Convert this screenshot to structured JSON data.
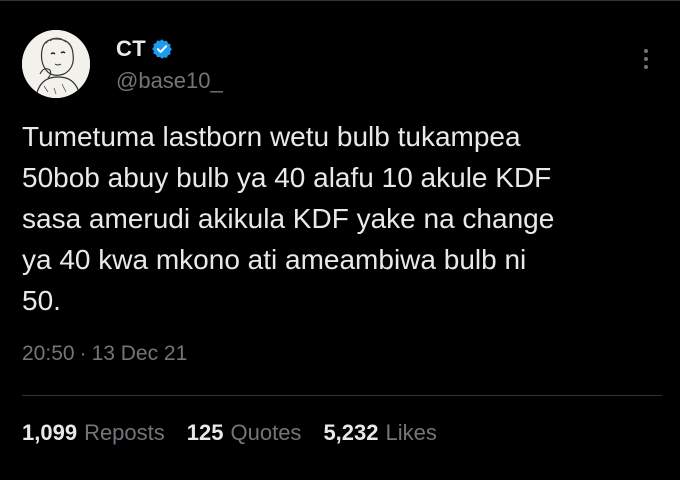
{
  "tweet": {
    "author": {
      "display_name": "CT",
      "handle": "@base10_",
      "verified": true,
      "verified_color": "#1d9bf0",
      "avatar_icon": "sketch-baby-avatar"
    },
    "text": "Tumetuma lastborn wetu bulb tukampea\n50bob abuy bulb ya 40 alafu 10 akule KDF\nsasa amerudi akikula KDF yake na change\nya 40 kwa mkono ati ameambiwa bulb ni\n50.",
    "time": "20:50",
    "separator": "·",
    "date": "13 Dec 21",
    "more_icon": "more-vertical-icon"
  },
  "stats": {
    "reposts": {
      "count": "1,099",
      "label": "Reposts"
    },
    "quotes": {
      "count": "125",
      "label": "Quotes"
    },
    "likes": {
      "count": "5,232",
      "label": "Likes"
    }
  },
  "colors": {
    "background": "#000000",
    "primary_text": "#e7e9ea",
    "secondary_text": "#71767b",
    "divider": "#2f3336"
  }
}
